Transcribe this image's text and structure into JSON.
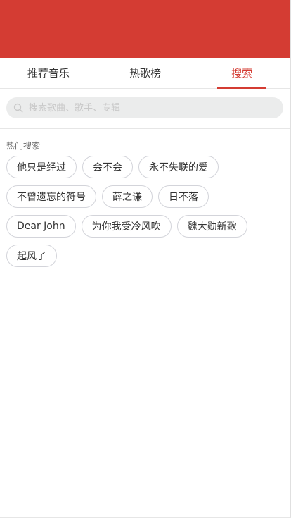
{
  "colors": {
    "brand": "#d43c33",
    "tag_border": "#d3d4da",
    "search_bg": "#ebecec"
  },
  "tabs": [
    {
      "label": "推荐音乐",
      "active": false
    },
    {
      "label": "热歌榜",
      "active": false
    },
    {
      "label": "搜索",
      "active": true
    }
  ],
  "search": {
    "placeholder": "搜索歌曲、歌手、专辑",
    "value": "",
    "icon": "search-icon"
  },
  "hot_search": {
    "title": "热门搜索",
    "tags": [
      "他只是经过",
      "会不会",
      "永不失联的爱",
      "不曾遗忘的符号",
      "薛之谦",
      "日不落",
      "Dear John",
      "为你我受冷风吹",
      "魏大勋新歌",
      "起风了"
    ]
  }
}
